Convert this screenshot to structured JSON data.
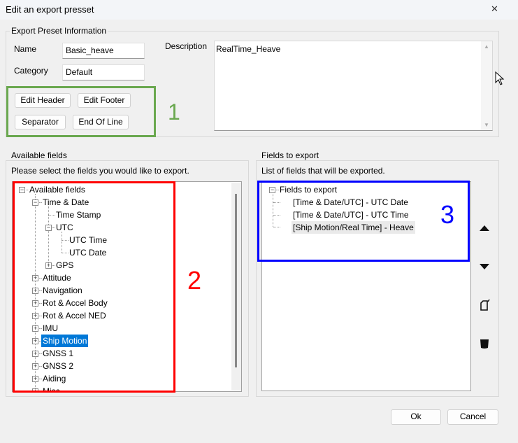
{
  "window": {
    "title": "Edit an export presset",
    "close": "✕"
  },
  "preset_info": {
    "group_label": "Export Preset Information",
    "name_label": "Name",
    "name_value": "Basic_heave",
    "category_label": "Category",
    "category_value": "Default",
    "description_label": "Description",
    "description_value": "RealTime_Heave"
  },
  "buttons": {
    "edit_header": "Edit Header",
    "edit_footer": "Edit Footer",
    "separator": "Separator",
    "end_of_line": "End Of Line",
    "ok": "Ok",
    "cancel": "Cancel"
  },
  "annotations": {
    "one": "1",
    "two": "2",
    "three": "3",
    "colors": {
      "one": "#6aa84f",
      "two": "#ff0000",
      "three": "#0000ff"
    }
  },
  "available": {
    "group_label": "Available fields",
    "hint": "Please select the fields you would like to export.",
    "root": "Available fields",
    "items": [
      {
        "label": "Time & Date",
        "level": 1,
        "toggle": "-"
      },
      {
        "label": "Time Stamp",
        "level": 2,
        "toggle": ""
      },
      {
        "label": "UTC",
        "level": 2,
        "toggle": "-"
      },
      {
        "label": "UTC Time",
        "level": 3,
        "toggle": ""
      },
      {
        "label": "UTC Date",
        "level": 3,
        "toggle": ""
      },
      {
        "label": "GPS",
        "level": 2,
        "toggle": "+"
      },
      {
        "label": "Attitude",
        "level": 1,
        "toggle": "+"
      },
      {
        "label": "Navigation",
        "level": 1,
        "toggle": "+"
      },
      {
        "label": "Rot & Accel Body",
        "level": 1,
        "toggle": "+"
      },
      {
        "label": "Rot & Accel NED",
        "level": 1,
        "toggle": "+"
      },
      {
        "label": "IMU",
        "level": 1,
        "toggle": "+"
      },
      {
        "label": "Ship Motion",
        "level": 1,
        "toggle": "+",
        "selected": true
      },
      {
        "label": "GNSS 1",
        "level": 1,
        "toggle": "+"
      },
      {
        "label": "GNSS 2",
        "level": 1,
        "toggle": "+"
      },
      {
        "label": "Aiding",
        "level": 1,
        "toggle": "+"
      },
      {
        "label": "Misc",
        "level": 1,
        "toggle": "+"
      }
    ]
  },
  "export": {
    "group_label": "Fields to export",
    "hint": "List of fields that will be exported.",
    "root": "Fields to export",
    "items": [
      "[Time & Date/UTC] - UTC Date",
      "[Time & Date/UTC] - UTC Time",
      "[Ship Motion/Real Time] - Heave"
    ],
    "side_icons": [
      "move-up-icon",
      "move-down-icon",
      "edit-icon",
      "trash-icon"
    ]
  }
}
